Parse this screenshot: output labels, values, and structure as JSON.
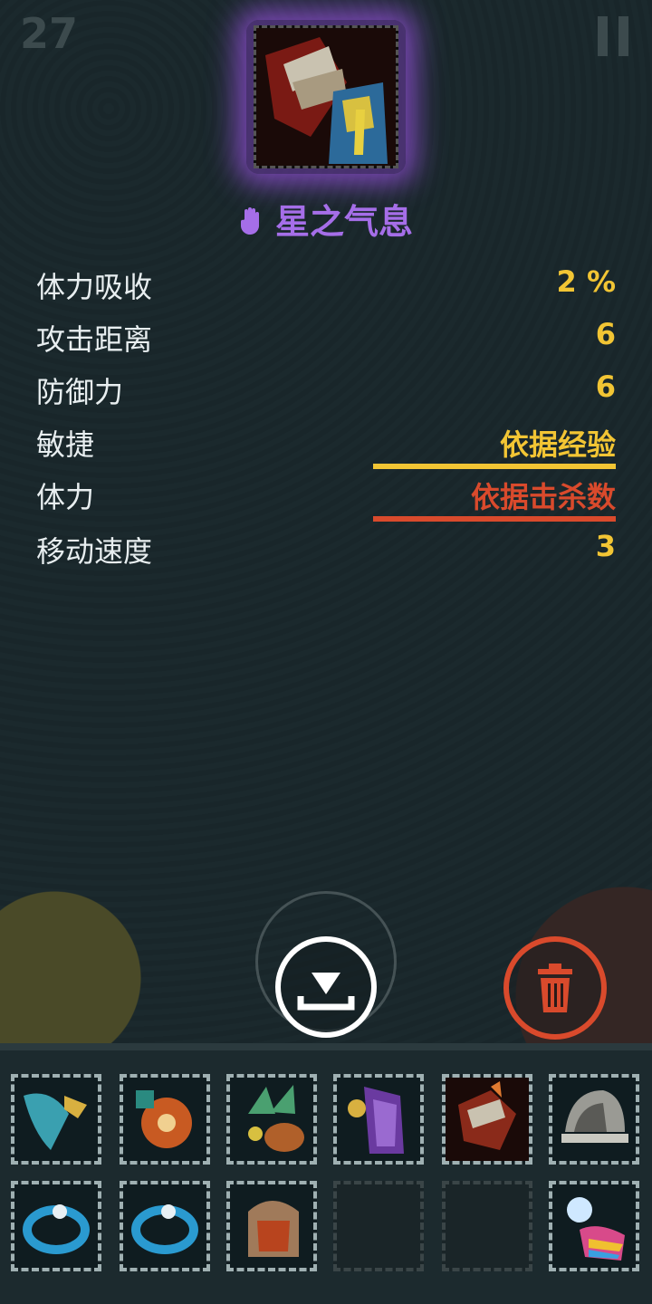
{
  "hud": {
    "level": "27"
  },
  "item": {
    "name": "星之气息",
    "name_color": "#a56ee8",
    "icon": "hand-icon",
    "glow_color": "#9650dc"
  },
  "stats": [
    {
      "name": "体力吸收",
      "value": "2 %",
      "color": "#f2c534"
    },
    {
      "name": "攻击距离",
      "value": "6",
      "color": "#f2c534"
    },
    {
      "name": "防御力",
      "value": "6",
      "color": "#f2c534"
    },
    {
      "name": "敏捷",
      "value": "依据经验",
      "color": "#f2c534",
      "bar_color": "#f2c534"
    },
    {
      "name": "体力",
      "value": "依据击杀数",
      "color": "#d94a2c",
      "bar_color": "#d94a2c"
    },
    {
      "name": "移动速度",
      "value": "3",
      "color": "#f2c534"
    }
  ],
  "actions": {
    "equip_icon": "download-icon",
    "trash_icon": "trash-icon",
    "trash_color": "#d94a2c"
  },
  "inventory": {
    "slots": [
      {
        "icon": "blade-icon",
        "empty": false
      },
      {
        "icon": "shield-icon",
        "empty": false
      },
      {
        "icon": "claw-icon",
        "empty": false
      },
      {
        "icon": "armor-icon",
        "empty": false
      },
      {
        "icon": "gauntlet-icon",
        "empty": false
      },
      {
        "icon": "helmet-icon",
        "empty": false
      },
      {
        "icon": "ring-icon",
        "empty": false
      },
      {
        "icon": "ring-icon",
        "empty": false
      },
      {
        "icon": "bracer-icon",
        "empty": false
      },
      {
        "icon": "empty-slot",
        "empty": true
      },
      {
        "icon": "empty-slot",
        "empty": true
      },
      {
        "icon": "glowing-ring-icon",
        "empty": false
      }
    ]
  }
}
